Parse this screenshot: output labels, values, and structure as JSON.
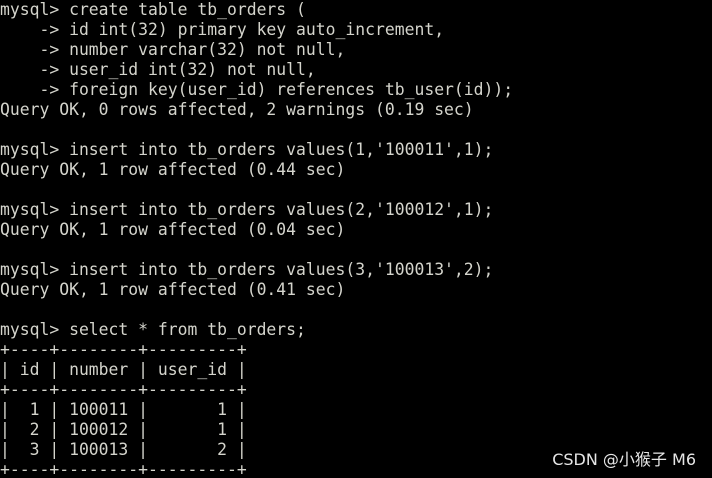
{
  "terminal": {
    "lines": [
      "mysql> create table tb_orders (",
      "    -> id int(32) primary key auto_increment,",
      "    -> number varchar(32) not null,",
      "    -> user_id int(32) not null,",
      "    -> foreign key(user_id) references tb_user(id));",
      "Query OK, 0 rows affected, 2 warnings (0.19 sec)",
      "",
      "mysql> insert into tb_orders values(1,'100011',1);",
      "Query OK, 1 row affected (0.44 sec)",
      "",
      "mysql> insert into tb_orders values(2,'100012',1);",
      "Query OK, 1 row affected (0.04 sec)",
      "",
      "mysql> insert into tb_orders values(3,'100013',2);",
      "Query OK, 1 row affected (0.41 sec)",
      "",
      "mysql> select * from tb_orders;",
      "+----+--------+---------+",
      "| id | number | user_id |",
      "+----+--------+---------+",
      "|  1 | 100011 |       1 |",
      "|  2 | 100012 |       1 |",
      "|  3 | 100013 |       2 |",
      "+----+--------+---------+"
    ]
  },
  "watermark": "CSDN @小猴子 M6"
}
